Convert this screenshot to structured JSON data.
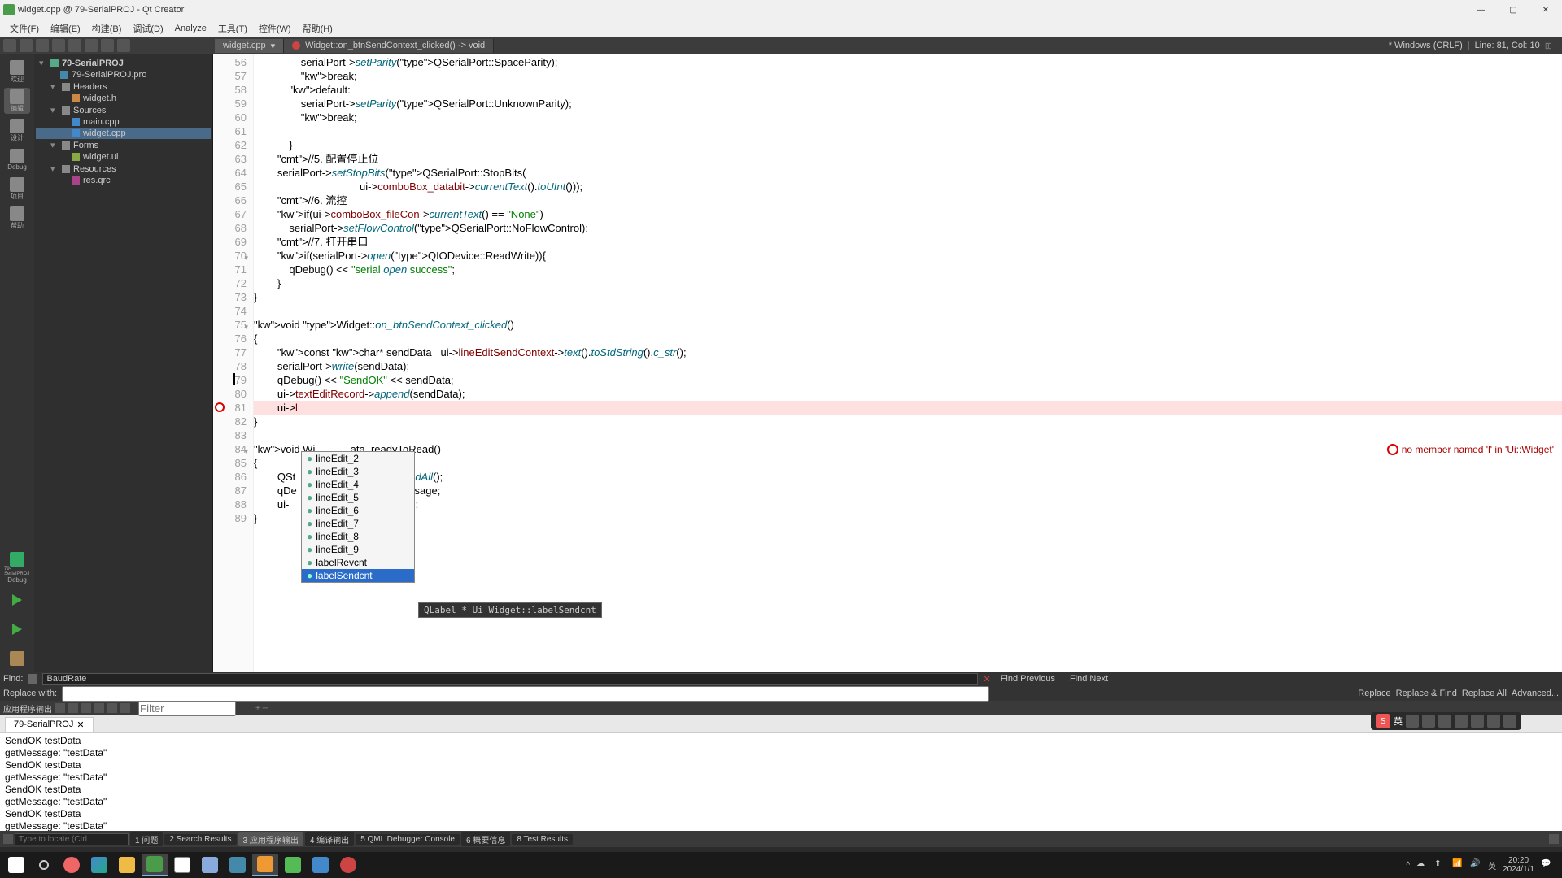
{
  "window": {
    "title": "widget.cpp @ 79-SerialPROJ - Qt Creator"
  },
  "menu": [
    "文件(F)",
    "编辑(E)",
    "构建(B)",
    "调试(D)",
    "Analyze",
    "工具(T)",
    "控件(W)",
    "帮助(H)"
  ],
  "tabs": [
    {
      "label": "widget.cpp",
      "active": true
    },
    {
      "label": "Widget::on_btnSendContext_clicked() -> void",
      "active": false
    }
  ],
  "statusbar": {
    "encoding": "* Windows (CRLF)",
    "pos": "Line: 81, Col: 10"
  },
  "project": {
    "root": "79-SerialPROJ",
    "items": [
      {
        "label": "79-SerialPROJ.pro",
        "depth": 1
      },
      {
        "label": "Headers",
        "depth": 1,
        "expandable": true
      },
      {
        "label": "widget.h",
        "depth": 2
      },
      {
        "label": "Sources",
        "depth": 1,
        "expandable": true
      },
      {
        "label": "main.cpp",
        "depth": 2
      },
      {
        "label": "widget.cpp",
        "depth": 2,
        "selected": true
      },
      {
        "label": "Forms",
        "depth": 1,
        "expandable": true
      },
      {
        "label": "widget.ui",
        "depth": 2
      },
      {
        "label": "Resources",
        "depth": 1,
        "expandable": true
      },
      {
        "label": "res.qrc",
        "depth": 2
      }
    ]
  },
  "leftbar": [
    "欢迎",
    "编辑",
    "设计",
    "Debug",
    "项目",
    "帮助"
  ],
  "leftrun": [
    "79-SerialPROJ",
    "Debug"
  ],
  "code": {
    "start": 56,
    "lines": [
      "                serialPort->setParity(QSerialPort::SpaceParity);",
      "                break;",
      "            default:",
      "                serialPort->setParity(QSerialPort::UnknownParity);",
      "                break;",
      "",
      "            }",
      "        //5. 配置停止位",
      "        serialPort->setStopBits(QSerialPort::StopBits(",
      "                                    ui->comboBox_databit->currentText().toUInt()));",
      "        //6. 流控",
      "        if(ui->comboBox_fileCon->currentText() == \"None\")",
      "            serialPort->setFlowControl(QSerialPort::NoFlowControl);",
      "        //7. 打开串口",
      "        if(serialPort->open(QIODevice::ReadWrite)){",
      "            qDebug() << \"serial open success\";",
      "        }",
      "}",
      "",
      "void Widget::on_btnSendContext_clicked()",
      "{",
      "        const char* sendData   ui->lineEditSendContext->text().toStdString().c_str();",
      "        serialPort->write(sendData);",
      "        qDebug() << \"SendOK\" << sendData;",
      "        ui->textEditRecord->append(sendData);",
      "        ui->l",
      "}",
      "",
      "void Wi            ata_readyToRead()",
      "{",
      "        QSt                 serialPort->readAll();",
      "        qDe             sage:\"<< revMessage;",
      "        ui-             pend(revMessage);",
      "}"
    ],
    "error": "no member named 'l' in 'Ui::Widget'",
    "foldLines": [
      70,
      75,
      84
    ],
    "errorLine": 81
  },
  "autocomplete": {
    "items": [
      "lineEdit_2",
      "lineEdit_3",
      "lineEdit_4",
      "lineEdit_5",
      "lineEdit_6",
      "lineEdit_7",
      "lineEdit_8",
      "lineEdit_9",
      "labelRevcnt",
      "labelSendcnt"
    ],
    "selected": 9,
    "tooltip": "QLabel * Ui_Widget::labelSendcnt"
  },
  "find": {
    "label": "Find:",
    "value": "BaudRate",
    "prev": "Find Previous",
    "next": "Find Next"
  },
  "replace": {
    "label": "Replace with:",
    "b1": "Replace",
    "b2": "Replace & Find",
    "b3": "Replace All",
    "b4": "Advanced..."
  },
  "bottombar": {
    "label": "应用程序输出",
    "filter": "Filter"
  },
  "outputTab": "79-SerialPROJ",
  "output": [
    "SendOK testData",
    "getMessage:  \"testData\"",
    "SendOK testData",
    "getMessage:  \"testData\"",
    "SendOK testData",
    "getMessage:  \"testData\"",
    "SendOK testData",
    "getMessage:  \"testData\""
  ],
  "bottompanes": [
    "1 问题",
    "2 Search Results",
    "3 应用程序输出",
    "4 编译输出",
    "5 QML Debugger Console",
    "6 概要信息",
    "8 Test Results"
  ],
  "locator": "Type to locate (Ctrl",
  "tray": {
    "time": "20:20",
    "date": "2024/1/1"
  }
}
